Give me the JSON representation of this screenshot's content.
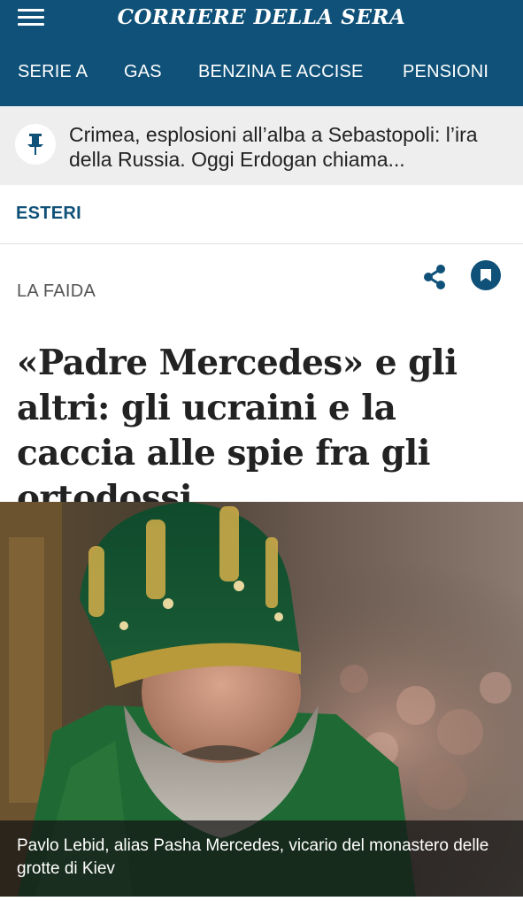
{
  "header": {
    "logo": "CORRIERE DELLA SERA",
    "menu_icon": "hamburger-menu-icon",
    "nav_tabs": [
      {
        "label": "SERIE A"
      },
      {
        "label": "GAS"
      },
      {
        "label": "BENZINA E ACCISE"
      },
      {
        "label": "PENSIONI"
      }
    ]
  },
  "pinned": {
    "icon": "pin-icon",
    "text": "Crimea, esplosioni all’alba a Sebastopoli: l’ira della Russia. Oggi Erdogan chiama..."
  },
  "section": "ESTERI",
  "article": {
    "kicker": "LA FAIDA",
    "share_icon": "share-icon",
    "bookmark_icon": "bookmark-icon",
    "headline": "«Padre Mercedes» e gli altri: gli ucraini e la caccia alle spie fra gli ortodossi",
    "photo_caption": "Pavlo Lebid, alias Pasha Mercedes, vicario del monastero delle grotte di Kiev"
  },
  "colors": {
    "brand_blue": "#0f5178",
    "pinned_bg": "#eeeeee"
  }
}
